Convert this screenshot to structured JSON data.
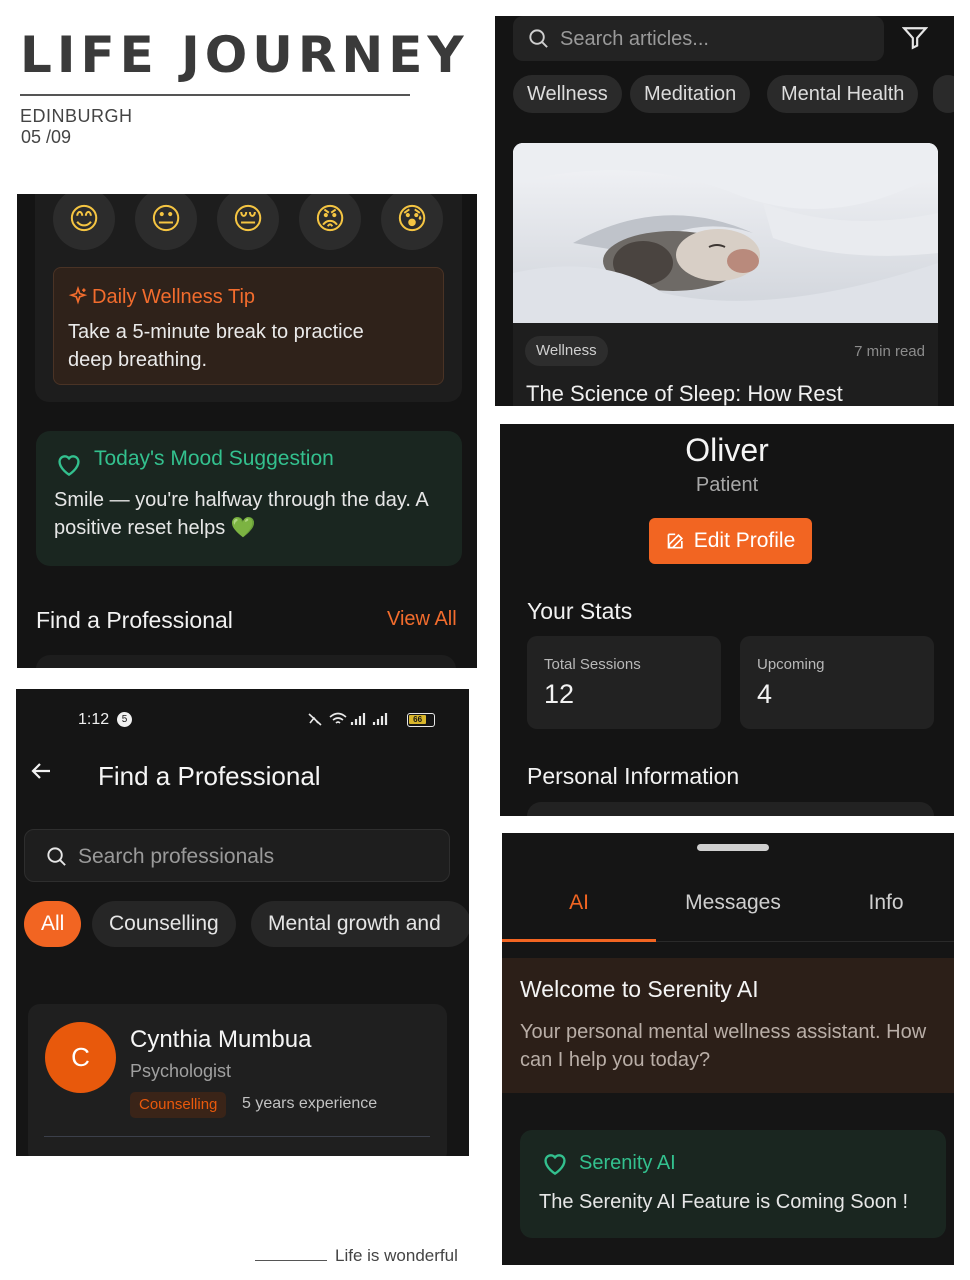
{
  "header": {
    "title": "LIFE  JOURNEY",
    "city": "EDINBURGH",
    "date": "05 /09"
  },
  "footer": {
    "text": "Life is wonderful"
  },
  "dashboard": {
    "moods": [
      "😊",
      "😐",
      "😔",
      "😡",
      "😰"
    ],
    "tip": {
      "title": "Daily Wellness Tip",
      "text": "Take a 5-minute break to practice deep breathing."
    },
    "mood_suggestion": {
      "title": "Today's Mood Suggestion",
      "text": "Smile — you're halfway through the day. A positive reset helps 💚"
    },
    "section_title": "Find a Professional",
    "view_all": "View All"
  },
  "articles": {
    "search_placeholder": "Search articles...",
    "chips": [
      "Wellness",
      "Meditation",
      "Mental Health"
    ],
    "card": {
      "tag": "Wellness",
      "read_time": "7 min read",
      "title": "The Science of Sleep: How Rest"
    }
  },
  "profile": {
    "name": "Oliver",
    "role": "Patient",
    "edit_label": "Edit Profile",
    "stats_title": "Your Stats",
    "stats": [
      {
        "label": "Total Sessions",
        "value": "12"
      },
      {
        "label": "Upcoming",
        "value": "4"
      }
    ],
    "personal_title": "Personal Information"
  },
  "find_pro": {
    "status": {
      "time": "1:12",
      "notif": "5",
      "battery": "66"
    },
    "title": "Find a Professional",
    "search_placeholder": "Search professionals",
    "filters": [
      "All",
      "Counselling",
      "Mental growth and"
    ],
    "professional": {
      "initial": "C",
      "name": "Cynthia Mumbua",
      "role": "Psychologist",
      "tag": "Counselling",
      "experience": "5 years experience"
    }
  },
  "serenity": {
    "tabs": [
      "AI",
      "Messages",
      "Info"
    ],
    "welcome_title": "Welcome to Serenity AI",
    "welcome_text": "Your personal mental wellness assistant. How can I help you today?",
    "card_title": "Serenity AI",
    "card_text": "The Serenity AI Feature is Coming Soon !"
  },
  "colors": {
    "accent": "#f26522",
    "green": "#33c08e",
    "panel_bg": "#141414"
  }
}
